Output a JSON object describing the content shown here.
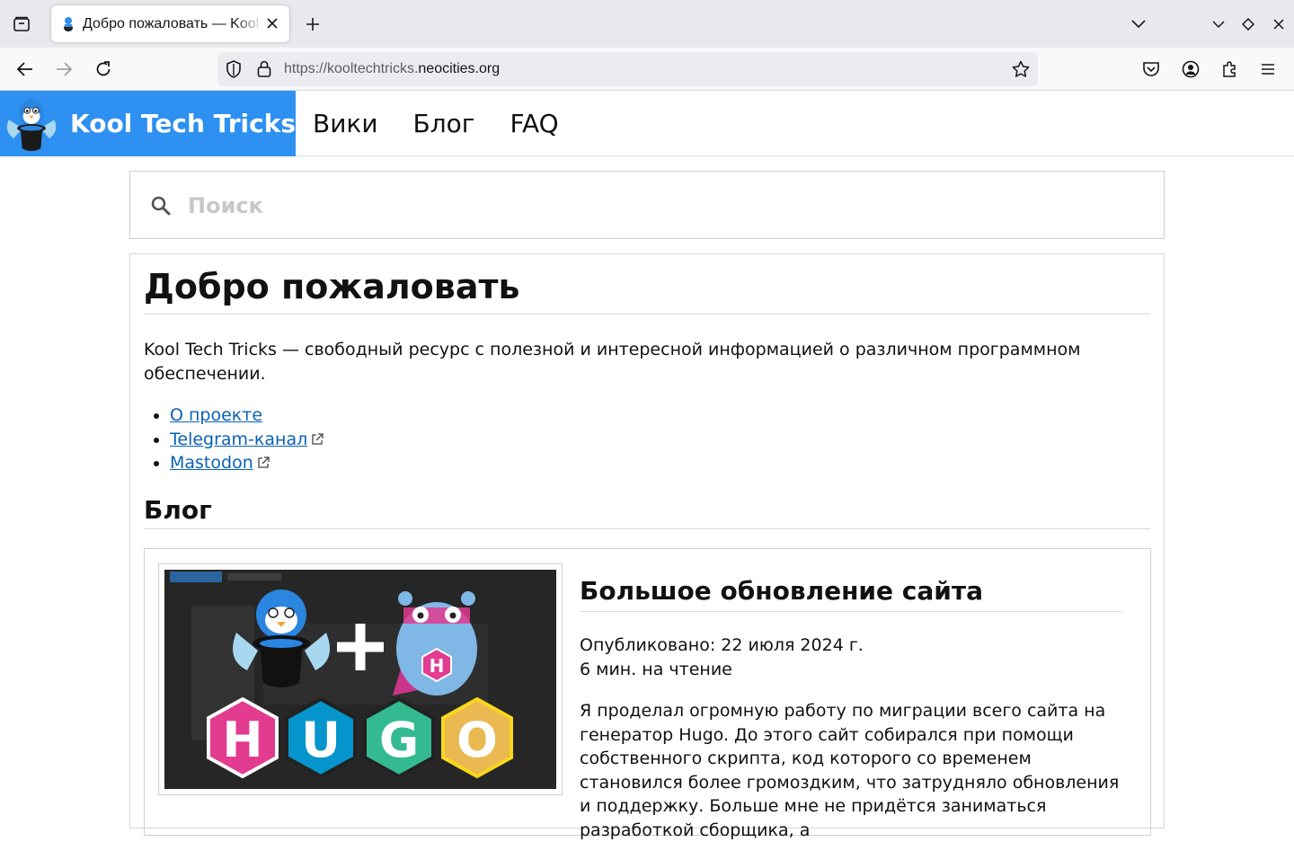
{
  "browser": {
    "tab_title": "Добро пожаловать — Kool Tech Tricks",
    "url_prefix": "https://kooltechtricks.",
    "url_domain": "neocities.org"
  },
  "header": {
    "brand": "Kool Tech Tricks",
    "brand_color": "#2e90f0",
    "nav": [
      "Вики",
      "Блог",
      "FAQ"
    ]
  },
  "search": {
    "placeholder": "Поиск"
  },
  "main": {
    "title": "Добро пожаловать",
    "intro": "Kool Tech Tricks — свободный ресурс с полезной и интересной информацией о различном программном обеспечении.",
    "links": [
      "О проекте",
      "Telegram-канал",
      "Mastodon"
    ],
    "link_color": "#0b62b7",
    "blog_heading": "Блог",
    "post": {
      "title": "Большое обновление сайта",
      "published": "Опубликовано: 22 июля 2024 г.",
      "read_time": "6 мин. на чтение",
      "excerpt": "Я проделал огромную работу по миграции всего сайта на генератор Hugo. До этого сайт собирался при помощи собственного скрипта, код которого со временем становился более громоздким, что затрудняло обновления и поддержку. Больше мне не придётся заниматься разработкой сборщика, а",
      "thumb_letters": [
        "H",
        "U",
        "G",
        "O"
      ],
      "thumb_badge": "H"
    }
  }
}
